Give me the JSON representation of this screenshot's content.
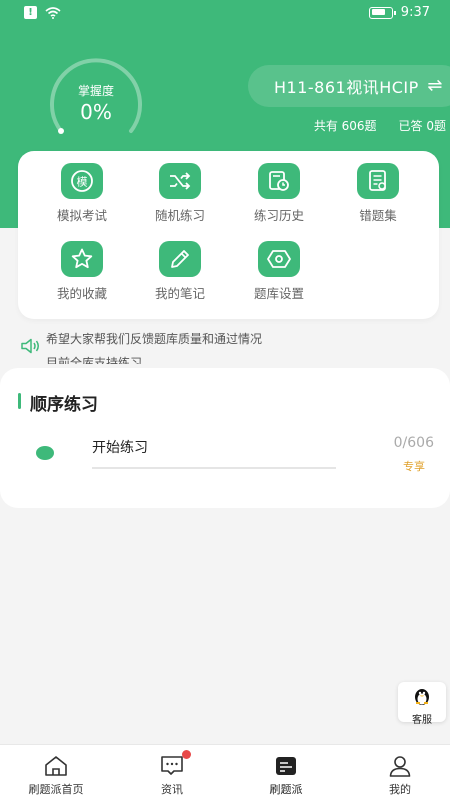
{
  "status_bar": {
    "time": "9:37"
  },
  "mastery": {
    "label": "掌握度",
    "value": "0%",
    "fraction": 0.0
  },
  "bank": {
    "name": "H11-861视讯HCIP",
    "swap_symbol": "⇌",
    "total": "共有 606题",
    "answered": "已答 0题"
  },
  "grid": [
    {
      "label": "模拟考试",
      "icon": "mock-exam-icon"
    },
    {
      "label": "随机练习",
      "icon": "shuffle-icon"
    },
    {
      "label": "练习历史",
      "icon": "history-icon"
    },
    {
      "label": "错题集",
      "icon": "wrong-questions-icon"
    },
    {
      "label": "我的收藏",
      "icon": "star-icon"
    },
    {
      "label": "我的笔记",
      "icon": "pencil-icon"
    },
    {
      "label": "题库设置",
      "icon": "settings-icon"
    }
  ],
  "grid_icon_glyph": "模",
  "notice": {
    "line1": "希望大家帮我们反馈题库质量和通过情况",
    "line2": "目前全库支持练习"
  },
  "practice": {
    "title": "顺序练习",
    "start_label": "开始练习",
    "count": "0/606",
    "progress_fraction": 0.0,
    "tag": "专享"
  },
  "support": {
    "label": "客服"
  },
  "tabs": [
    {
      "label": "刷题派首页",
      "icon": "home-icon"
    },
    {
      "label": "资讯",
      "icon": "message-icon"
    },
    {
      "label": "刷题派",
      "icon": "bank-icon"
    },
    {
      "label": "我的",
      "icon": "profile-icon"
    }
  ],
  "colors": {
    "brand": "#3eb97a",
    "badge": "#e84a4a",
    "tag": "#e0a02a"
  }
}
